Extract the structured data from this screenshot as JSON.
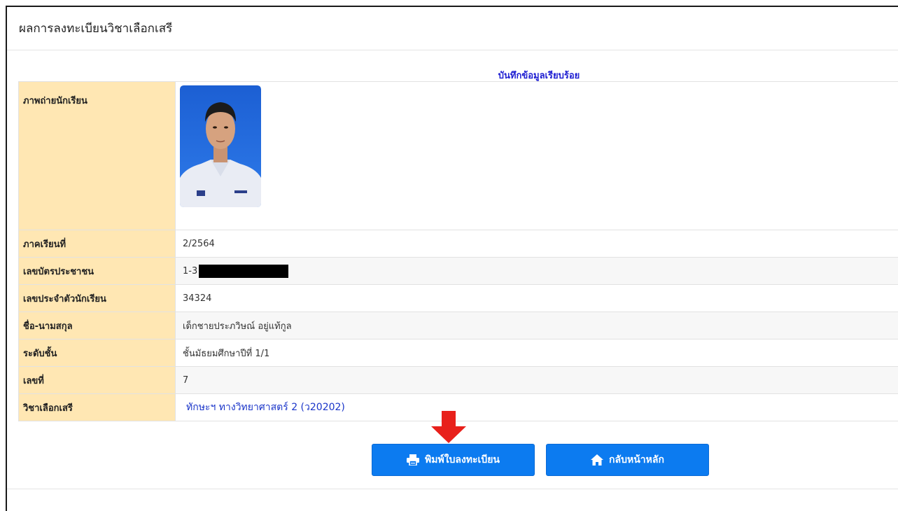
{
  "header": {
    "title": "ผลการลงทะเบียนวิชาเลือกเสรี"
  },
  "status": {
    "message": "บันทึกข้อมูลเรียบร้อย",
    "color": "#1e1ed2"
  },
  "table": {
    "photo_label": "ภาพถ่ายนักเรียน",
    "rows": [
      {
        "label": "ภาคเรียนที่",
        "value": "2/2564"
      },
      {
        "label": "เลขบัตรประชาชน",
        "value": "1-3"
      },
      {
        "label": "เลขประจำตัวนักเรียน",
        "value": "34324"
      },
      {
        "label": "ชื่อ-นามสกุล",
        "value": "เด็กชายประภวิษณ์ อยู่แท้กูล"
      },
      {
        "label": "ระดับชั้น",
        "value": "ชั้นมัธยมศึกษาปีที่ 1/1"
      },
      {
        "label": "เลขที่",
        "value": "7"
      },
      {
        "label": "วิชาเลือกเสรี",
        "value": "ทักษะฯ ทางวิทยาศาสตร์ 2 (ว20202)"
      }
    ]
  },
  "buttons": {
    "print_label": "พิมพ์ใบลงทะเบียน",
    "home_label": "กลับหน้าหลัก"
  },
  "colors": {
    "label_bg": "#ffe7b3",
    "button_bg": "#0c7bf0",
    "arrow": "#e8201b",
    "link": "#1a35c9"
  },
  "icons": {
    "print": "printer-icon",
    "home": "home-icon",
    "annotation": "down-arrow-icon"
  }
}
